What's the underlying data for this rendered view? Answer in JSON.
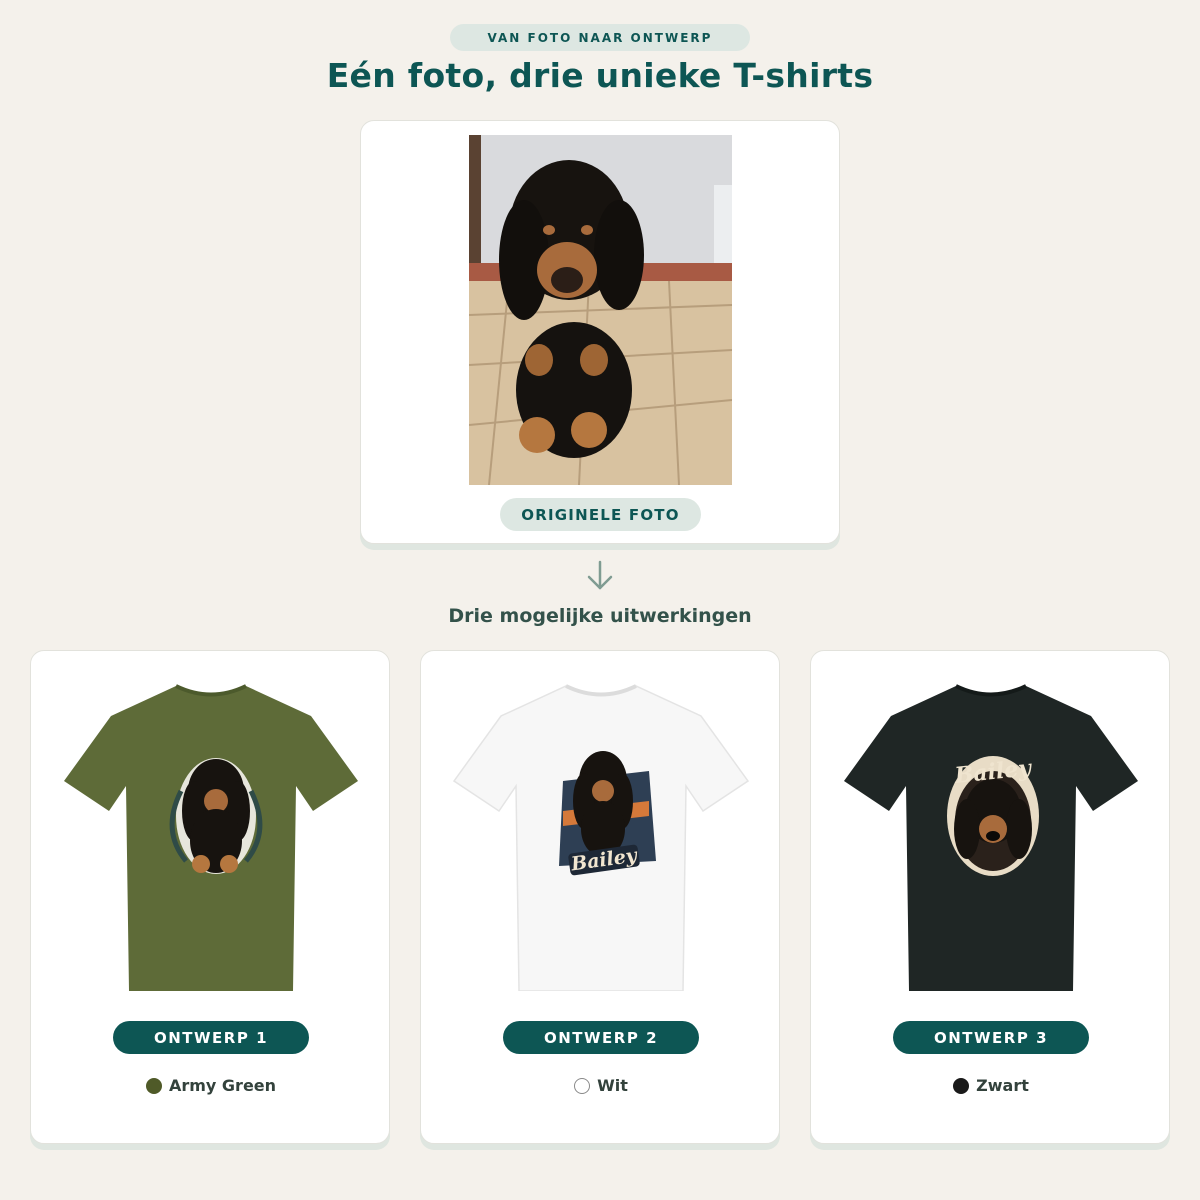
{
  "header": {
    "eyebrow": "VAN FOTO NAAR ONTWERP",
    "title": "Eén foto, drie unieke T-shirts"
  },
  "original": {
    "caption": "ORIGINELE FOTO"
  },
  "subtitle": "Drie mogelijke uitwerkingen",
  "designs": [
    {
      "label": "ONTWERP 1",
      "color_name": "Army Green",
      "shirt_color": "#5e6b38",
      "swatch_color": "#4f5a28",
      "print_text": ""
    },
    {
      "label": "ONTWERP 2",
      "color_name": "Wit",
      "shirt_color": "#f7f7f7",
      "swatch_color": "#ffffff",
      "print_text": "Bailey"
    },
    {
      "label": "ONTWERP 3",
      "color_name": "Zwart",
      "shirt_color": "#1f2625",
      "swatch_color": "#1a1a1a",
      "print_text": "Bailey"
    }
  ],
  "colors": {
    "accent": "#0d5654",
    "background": "#f4f1eb",
    "pill": "#dde7e2"
  },
  "icons": [
    "arrow-down-icon"
  ]
}
